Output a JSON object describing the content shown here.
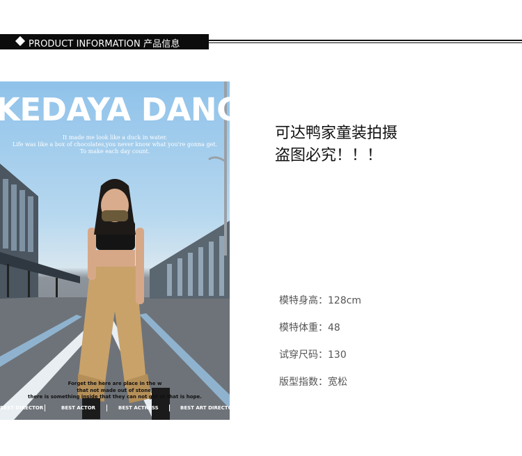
{
  "header": {
    "title": "PRODUCT INFORMATION 产品信息"
  },
  "photo": {
    "title": "KEDAYA DANCE",
    "subtitle_lines": [
      "It made me look like a duck in water.",
      "Life was like a box of chocolates,you never know what you're gonna get.",
      "To make each day count."
    ],
    "bottom_lines": [
      "Forget the here are place in the w",
      "that not made out of stone,",
      "there is something inside that they can not get at that is hope."
    ],
    "credits": [
      "BEST DIRECTOR",
      "BEST ACTOR",
      "BEST ACTRESS",
      "BEST ART DIRECTOR"
    ]
  },
  "notice": {
    "line1": "可达鸭家童装拍摄",
    "line2": "盗图必究！！！"
  },
  "specs": [
    {
      "label": "模特身高：",
      "value": "128cm"
    },
    {
      "label": "模特体重：",
      "value": "48"
    },
    {
      "label": "试穿尺码：",
      "value": "130"
    },
    {
      "label": "版型指数：",
      "value": "宽松"
    }
  ],
  "colors": {
    "header_bg": "#0c0c0c",
    "header_text": "#ffffff",
    "spec_text": "#555555"
  }
}
